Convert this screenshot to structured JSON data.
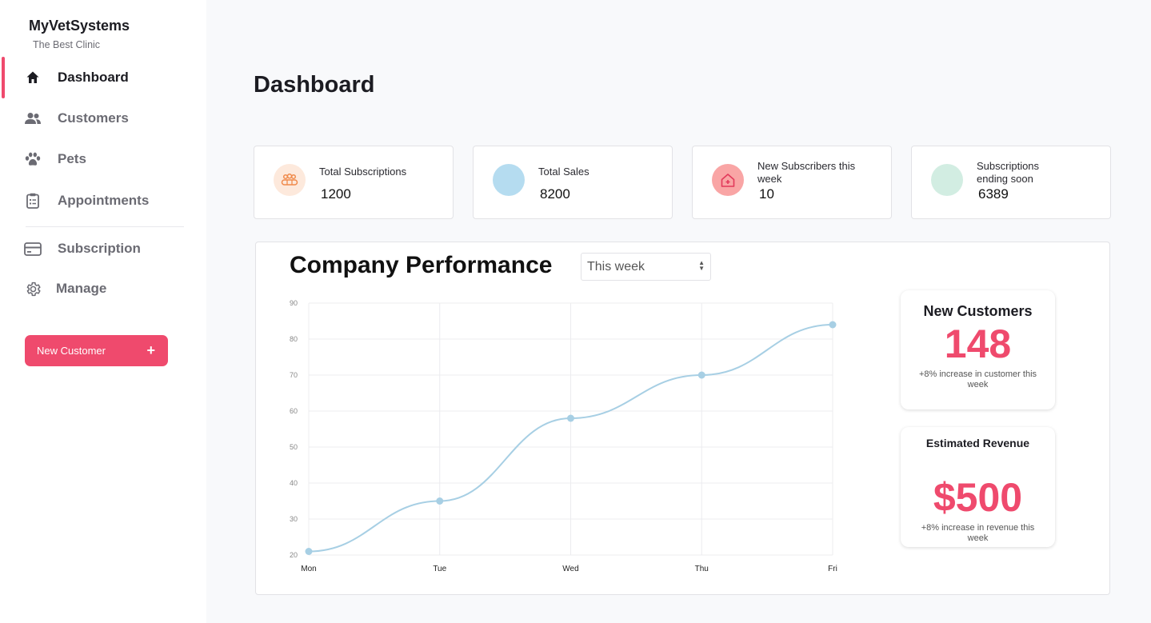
{
  "brand": {
    "name": "MyVetSystems",
    "tagline": "The Best Clinic"
  },
  "sidebar": {
    "items": [
      {
        "label": "Dashboard",
        "icon": "home-icon",
        "active": true
      },
      {
        "label": "Customers",
        "icon": "users-icon"
      },
      {
        "label": "Pets",
        "icon": "paw-icon"
      },
      {
        "label": "Appointments",
        "icon": "clipboard-icon"
      },
      {
        "label": "Subscription",
        "icon": "credit-card-icon"
      },
      {
        "label": "Manage",
        "icon": "gear-icon"
      }
    ],
    "new_customer_label": "New Customer",
    "new_customer_icon": "+"
  },
  "page": {
    "title": "Dashboard"
  },
  "cards": [
    {
      "title": "Total Subscriptions",
      "value": "1200",
      "icon": "people-group-icon",
      "circle_color": "#fde9dc"
    },
    {
      "title": "Total Sales",
      "value": "8200",
      "icon": "blank-circle",
      "circle_color": "#b5dcf0"
    },
    {
      "title": "New Subscribers this week",
      "value": "10",
      "icon": "house-plus-icon",
      "circle_color": "#f9a5a5"
    },
    {
      "title": "Subscriptions ending soon",
      "value": "6389",
      "icon": "blank-circle",
      "circle_color": "#d2ede2"
    }
  ],
  "performance": {
    "title": "Company Performance",
    "period_selected": "This week"
  },
  "chart_data": {
    "type": "line",
    "x": [
      "Mon",
      "Tue",
      "Wed",
      "Thu",
      "Fri"
    ],
    "series": [
      {
        "values": [
          21,
          35,
          58,
          70,
          84
        ],
        "color": "#a7cfe4"
      }
    ],
    "yticks": [
      20,
      30,
      40,
      50,
      60,
      70,
      80,
      90
    ],
    "ylim": [
      20,
      90
    ],
    "grid": true,
    "title": "",
    "xlabel": "",
    "ylabel": ""
  },
  "stats": {
    "new_customers": {
      "title": "New Customers",
      "value": "148",
      "note": "+8% increase in customer this week"
    },
    "revenue": {
      "title": "Estimated Revenue",
      "value": "$500",
      "note": "+8% increase in revenue this week"
    }
  },
  "colors": {
    "accent": "#ef4a6d",
    "line": "#a7cfe4"
  }
}
